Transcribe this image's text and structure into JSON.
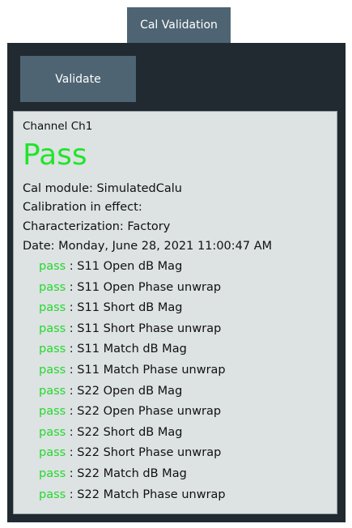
{
  "tab": {
    "label": "Cal Validation"
  },
  "toolbar": {
    "validate_label": "Validate"
  },
  "result": {
    "channel": "Channel Ch1",
    "status": "Pass",
    "cal_module": "Cal module: SimulatedCalu",
    "calibration_in_effect": "Calibration in effect:",
    "characterization": "Characterization: Factory",
    "date": "Date: Monday, June 28, 2021 11:00:47 AM",
    "checks": [
      {
        "status": "pass",
        "label": " : S11 Open dB Mag"
      },
      {
        "status": "pass",
        "label": " : S11 Open Phase unwrap"
      },
      {
        "status": "pass",
        "label": " : S11 Short dB Mag"
      },
      {
        "status": "pass",
        "label": " : S11 Short Phase unwrap"
      },
      {
        "status": "pass",
        "label": " : S11 Match dB Mag"
      },
      {
        "status": "pass",
        "label": " : S11 Match Phase unwrap"
      },
      {
        "status": "pass",
        "label": " : S22 Open dB Mag"
      },
      {
        "status": "pass",
        "label": " : S22 Open Phase unwrap"
      },
      {
        "status": "pass",
        "label": " : S22 Short dB Mag"
      },
      {
        "status": "pass",
        "label": " : S22 Short Phase unwrap"
      },
      {
        "status": "pass",
        "label": " : S22 Match dB Mag"
      },
      {
        "status": "pass",
        "label": " : S22 Match Phase unwrap"
      }
    ]
  },
  "colors": {
    "tab_bg": "#4e6473",
    "frame_bg": "#202a30",
    "panel_bg": "#dde2e3",
    "pass_green": "#22e42b"
  }
}
